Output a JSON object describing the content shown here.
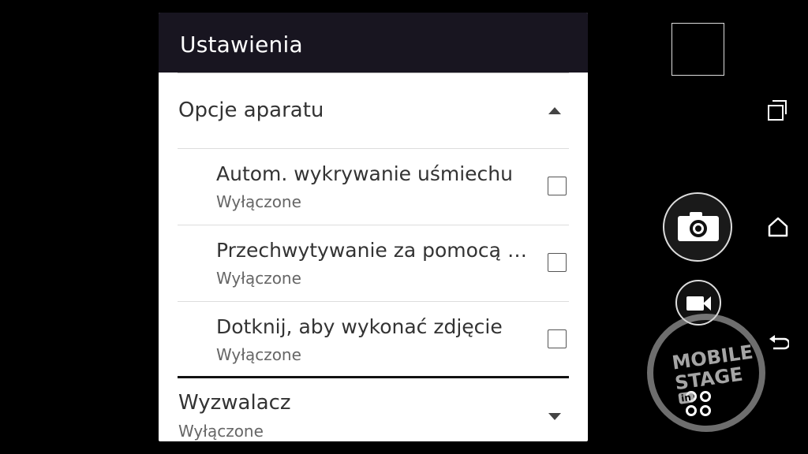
{
  "panel": {
    "title": "Ustawienia",
    "section_camera_options": {
      "title": "Opcje aparatu",
      "expanded": true,
      "items": [
        {
          "title": "Autom. wykrywanie uśmiechu",
          "status": "Wyłączone",
          "checked": false
        },
        {
          "title": "Przechwytywanie za pomocą gło…",
          "status": "Wyłączone",
          "checked": false
        },
        {
          "title": "Dotknij, aby wykonać zdjęcie",
          "status": "Wyłączone",
          "checked": false
        }
      ]
    },
    "section_trigger": {
      "title": "Wyzwalacz",
      "status": "Wyłączone",
      "expanded": false
    }
  },
  "controls": {
    "thumbnail": "last-photo-thumbnail",
    "shutter_icon": "camera-icon",
    "video_icon": "video-camera-icon",
    "mode_icon": "four-dots-icon"
  },
  "nav": {
    "recents_icon": "recent-apps-icon",
    "home_icon": "home-icon",
    "back_icon": "back-icon"
  },
  "watermark": {
    "line1": "MOBILE",
    "line2": "STAGE",
    "badge": "in"
  },
  "colors": {
    "header_bg": "#181520",
    "background": "#000000",
    "panel_bg": "#ffffff"
  }
}
